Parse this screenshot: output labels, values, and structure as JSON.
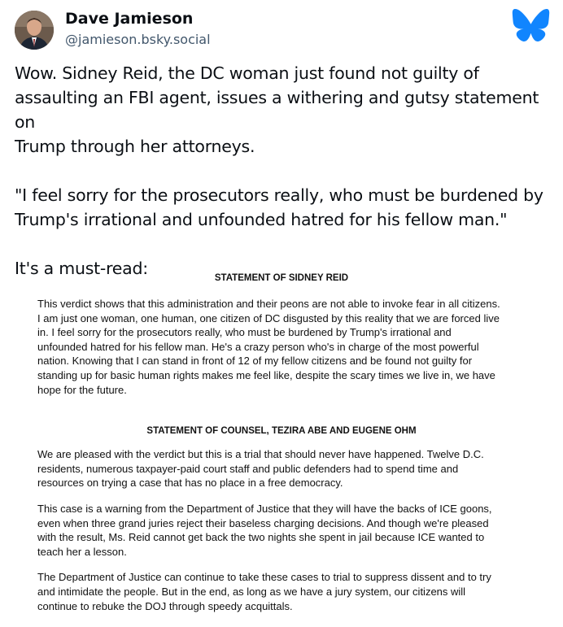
{
  "author": {
    "display_name": "Dave Jamieson",
    "handle": "@jamieson.bsky.social"
  },
  "icons": {
    "avatar": "author-avatar-photo",
    "logo": "bluesky-butterfly-icon",
    "brand_color": "#1185fe"
  },
  "post": {
    "paragraphs": [
      "Wow. Sidney Reid, the DC woman just found not guilty of\nassaulting an FBI agent, issues a withering and gutsy statement on\nTrump through her attorneys.",
      "\"I feel sorry for the prosecutors really, who must be burdened by\nTrump's irrational and unfounded hatred for his fellow man.\"",
      "It's a must-read:"
    ]
  },
  "attachment": {
    "statement_heading": "STATEMENT OF SIDNEY REID",
    "statement_body": "This verdict shows that this administration and their peons are not able to invoke fear in all citizens.\nI am just one woman, one human, one citizen of DC disgusted by this reality that we are forced live\nin.  I feel sorry for the prosecutors really, who must be burdened by Trump's irrational and\nunfounded hatred for his fellow man. He's a crazy person who's in charge of the most powerful\nnation. Knowing that I can stand in front of 12 of my fellow citizens and be found not guilty for\nstanding up for basic human rights makes me feel like, despite the scary times we live in, we have\nhope for the future.",
    "counsel_heading": "STATEMENT OF COUNSEL, TEZIRA ABE AND EUGENE OHM",
    "counsel_paragraphs": [
      "We are pleased with the verdict but this is a trial that should never have happened.  Twelve D.C.\nresidents, numerous taxpayer-paid court staff and public defenders had to spend time and\nresources on trying a case that has no place in a free democracy.",
      " This case is a warning from the Department of Justice that they will have the backs of ICE goons,\neven when three grand juries reject their baseless charging decisions.  And though we're pleased\nwith the result, Ms. Reid cannot get back the two nights she spent in jail because ICE wanted to\nteach her a lesson.",
      " The Department of Justice can continue to take these cases to trial to suppress dissent and to try\nand intimidate the people.  But in the end, as long as we have a jury system, our citizens will\ncontinue to rebuke the DOJ through speedy acquittals."
    ]
  }
}
